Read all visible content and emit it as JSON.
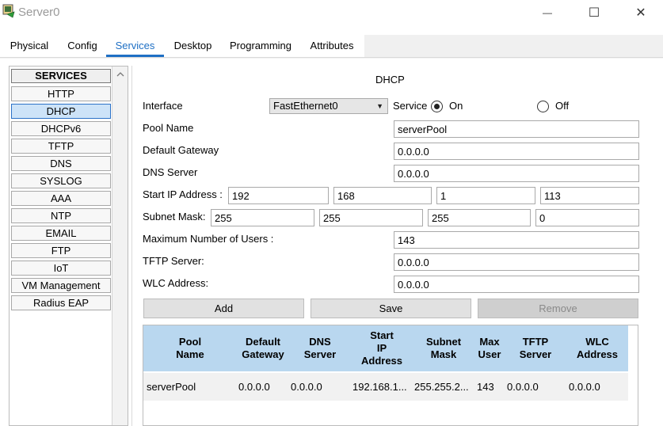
{
  "window": {
    "title": "Server0",
    "minimize_glyph": "—",
    "maximize_glyph": "☐",
    "close_glyph": "✕"
  },
  "tabs": [
    {
      "label": "Physical"
    },
    {
      "label": "Config"
    },
    {
      "label": "Services"
    },
    {
      "label": "Desktop"
    },
    {
      "label": "Programming"
    },
    {
      "label": "Attributes"
    }
  ],
  "services": {
    "header": "SERVICES",
    "items": [
      "HTTP",
      "DHCP",
      "DHCPv6",
      "TFTP",
      "DNS",
      "SYSLOG",
      "AAA",
      "NTP",
      "EMAIL",
      "FTP",
      "IoT",
      "VM Management",
      "Radius EAP"
    ],
    "selected": "DHCP"
  },
  "dhcp": {
    "title": "DHCP",
    "interface_label": "Interface",
    "interface_value": "FastEthernet0",
    "service_label": "Service",
    "on_label": "On",
    "off_label": "Off",
    "service_state": "on",
    "pool_name_label": "Pool Name",
    "pool_name": "serverPool",
    "default_gateway_label": "Default Gateway",
    "default_gateway": "0.0.0.0",
    "dns_server_label": "DNS Server",
    "dns_server": "0.0.0.0",
    "start_ip_label": "Start IP Address :",
    "start_ip": [
      "192",
      "168",
      "1",
      "113"
    ],
    "subnet_mask_label": "Subnet Mask:",
    "subnet_mask": [
      "255",
      "255",
      "255",
      "0"
    ],
    "max_users_label": "Maximum Number of Users :",
    "max_users": "143",
    "tftp_server_label": "TFTP Server:",
    "tftp_server": "0.0.0.0",
    "wlc_address_label": "WLC Address:",
    "wlc_address": "0.0.0.0",
    "add_label": "Add",
    "save_label": "Save",
    "remove_label": "Remove"
  },
  "table": {
    "headers": [
      "Pool\nName",
      "Default\nGateway",
      "DNS\nServer",
      "Start\nIP\nAddress",
      "Subnet\nMask",
      "Max\nUser",
      "TFTP\nServer",
      "WLC\nAddress"
    ],
    "rows": [
      [
        "serverPool",
        "0.0.0.0",
        "0.0.0.0",
        "192.168.1...",
        "255.255.2...",
        "143",
        "0.0.0.0",
        "0.0.0.0"
      ]
    ]
  }
}
